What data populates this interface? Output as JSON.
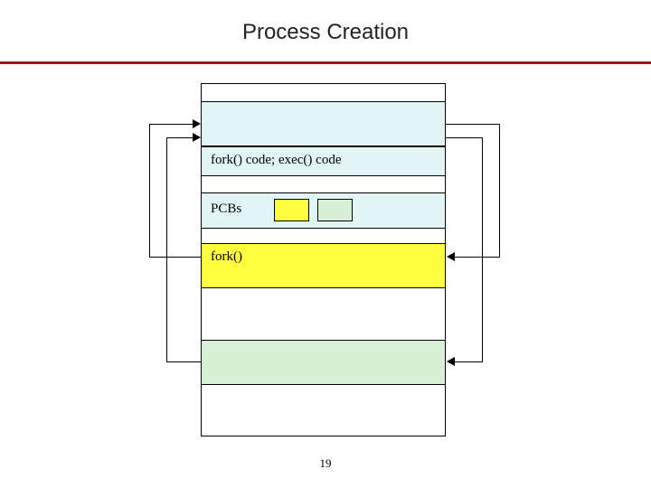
{
  "meta": {
    "domain": "Diagram"
  },
  "title": "Process Creation",
  "labels": {
    "code_band": "fork() code; exec() code",
    "pcb_band": "PCBs",
    "fork_band": "fork()"
  },
  "colors": {
    "accent_rule": "#9b1c1e",
    "kernel_band": "#e1f5f5",
    "highlight_yellow": "#ffff3f",
    "highlight_green": "#d8efd7"
  },
  "page_number": "19"
}
